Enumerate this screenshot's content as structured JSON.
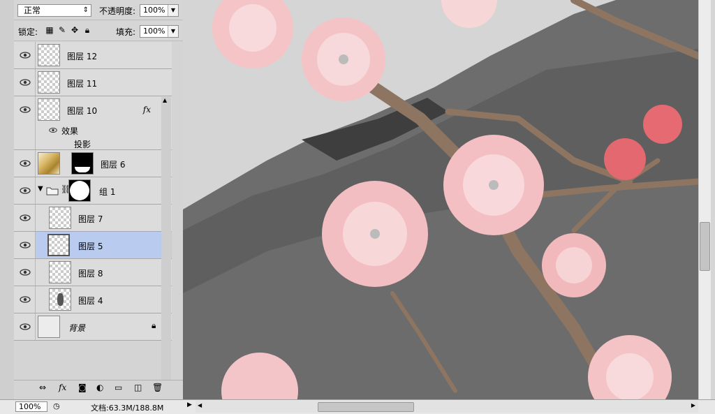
{
  "options": {
    "blend_mode": "正常",
    "opacity_label": "不透明度:",
    "opacity_value": "100%",
    "lock_label": "锁定:",
    "fill_label": "填充:",
    "fill_value": "100%"
  },
  "layers": [
    {
      "name": "图层 12"
    },
    {
      "name": "图层 11"
    },
    {
      "name": "图层 10",
      "fx": "fx"
    },
    {
      "name": "效果"
    },
    {
      "name": "投影"
    },
    {
      "name": "图层 6"
    },
    {
      "name": "组 1"
    },
    {
      "name": "图层 7"
    },
    {
      "name": "图层 5"
    },
    {
      "name": "图层 8"
    },
    {
      "name": "图层 4"
    },
    {
      "name": "背景"
    }
  ],
  "status": {
    "zoom": "100%",
    "doc_info": "文档:63.3M/188.8M"
  }
}
